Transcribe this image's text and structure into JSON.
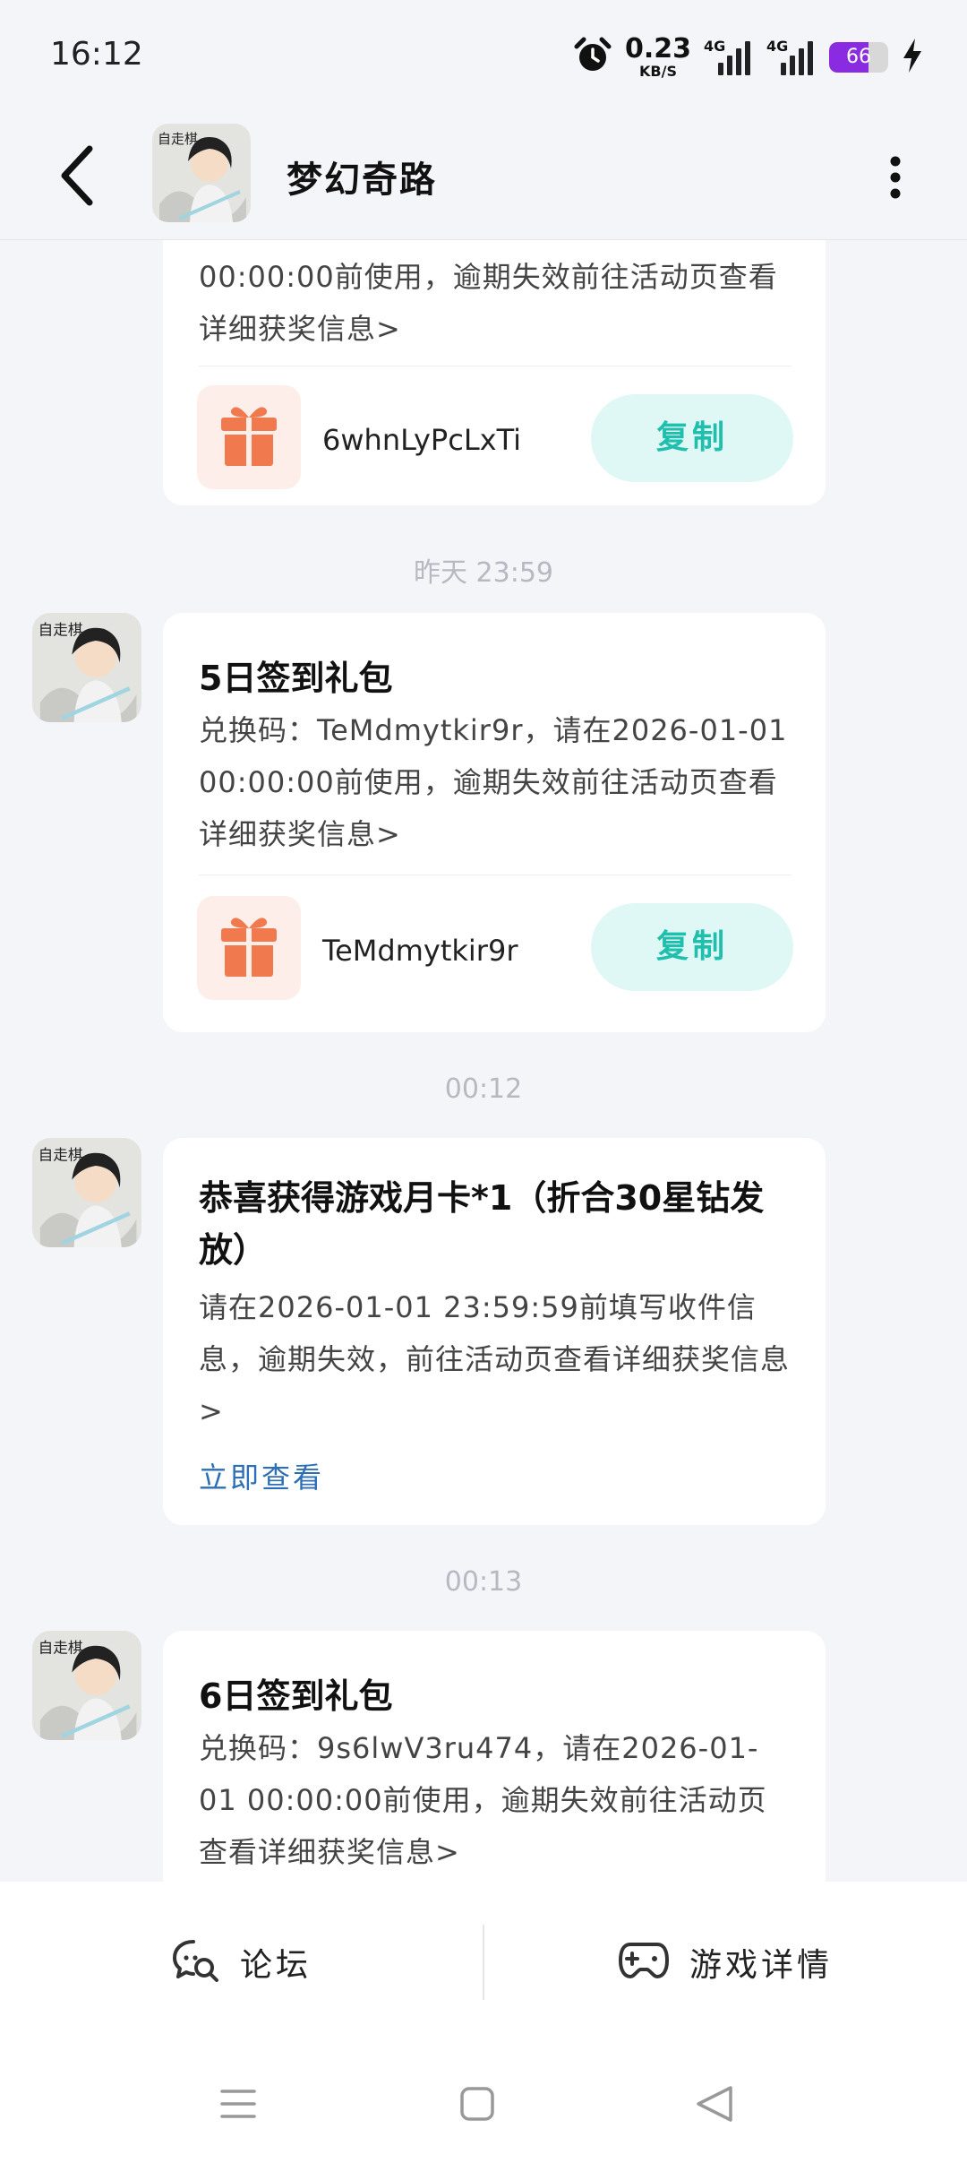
{
  "status": {
    "time": "16:12",
    "net_speed": "0.23",
    "net_unit": "KB/S",
    "signal_1": "4G",
    "signal_2": "4G",
    "battery": "66",
    "battery_level": 0.66,
    "colors": {
      "battery": "#8a2be2"
    }
  },
  "header": {
    "title": "梦幻奇路",
    "avatar_caption": "自走棋"
  },
  "messages": [
    {
      "text": "00:00:00前使用，逾期失效前往活动页查看详细获奖信息>",
      "code": "6whnLyPcLxTi",
      "copy_label": "复制"
    },
    {
      "timestamp": "昨天 23:59",
      "title": "5日签到礼包",
      "text": "兑换码：TeMdmytkir9r，请在2026-01-01 00:00:00前使用，逾期失效前往活动页查看详细获奖信息>",
      "code": "TeMdmytkir9r",
      "copy_label": "复制"
    },
    {
      "timestamp": "00:12",
      "title": "恭喜获得游戏月卡*1（折合30星钻发放）",
      "text": "请在2026-01-01 23:59:59前填写收件信息，逾期失效，前往活动页查看详细获奖信息>",
      "link_label": "立即查看"
    },
    {
      "timestamp": "00:13",
      "title": "6日签到礼包",
      "text": "兑换码：9s6lwV3ru474，请在2026-01-01 00:00:00前使用，逾期失效前往活动页查看详细获奖信息>"
    }
  ],
  "bottom_tabs": {
    "forum": "论坛",
    "game_details": "游戏详情"
  },
  "colors": {
    "accent": "#1fbfae",
    "copy_bg": "#dff7f5",
    "gift": "#f07a4e",
    "link": "#2d6fb6",
    "background": "#f4f5f8"
  }
}
